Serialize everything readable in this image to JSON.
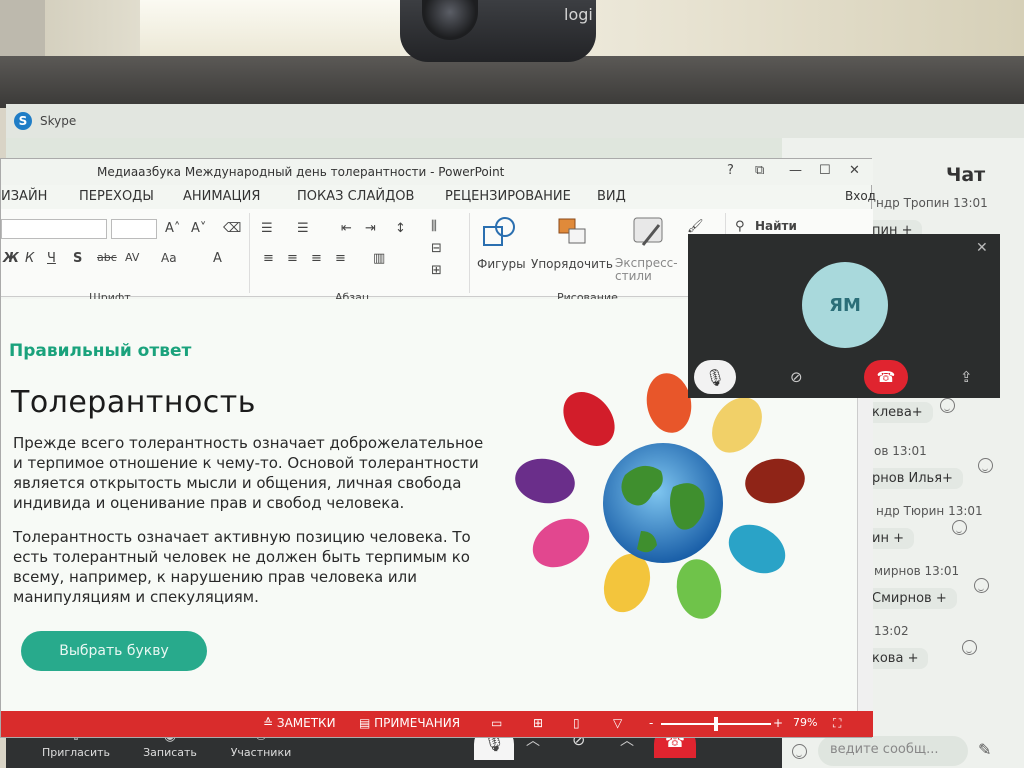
{
  "webcam": {
    "brand": "logi"
  },
  "skype": {
    "title": "Skype",
    "chat": {
      "header": "Чат",
      "rows": [
        {
          "text": "ндр Тропин 13:01"
        },
        {
          "text": "пин +"
        },
        {
          "text": "клева+"
        },
        {
          "text": "ов 13:01"
        },
        {
          "text": "рнов Илья+"
        },
        {
          "text": "ндр Тюрин 13:01"
        },
        {
          "text": "ин +"
        },
        {
          "text": "мирнов 13:01"
        },
        {
          "text": "Смирнов +"
        },
        {
          "text": "13:02"
        },
        {
          "text": "кова +"
        }
      ],
      "input_placeholder": "ведите сообщ..."
    },
    "call_bar": {
      "invite_label": "Пригласить",
      "record_label": "Записать",
      "participants_label": "Участники"
    },
    "call_preview": {
      "initials": "ЯМ"
    }
  },
  "ppt": {
    "title": "Медиаазбука Международный день толерантности - PowerPoint",
    "help": "?",
    "tabs": [
      "ИЗАЙН",
      "ПЕРЕХОДЫ",
      "АНИМАЦИЯ",
      "ПОКАЗ СЛАЙДОВ",
      "РЕЦЕНЗИРОВАНИЕ",
      "ВИД"
    ],
    "signin": "Вход",
    "ribbon": {
      "group_font": "Шрифт",
      "group_paragraph": "Абзац",
      "group_drawing": "Рисование",
      "shapes": "Фигуры",
      "arrange": "Упорядочить",
      "express": "Экспресс-\nстили",
      "find": "Найти"
    },
    "slide": {
      "correct_answer": "Правильный ответ",
      "title": "Толерантность",
      "para1": "Прежде всего толерантность означает доброжелательное и терпимое отношение к чему-то. Основой толерантности является открытость мысли и общения, личная свобода индивида и оценивание прав и свобод человека.",
      "para2": "Толерантность означает активную позицию человека. То есть толерантный человек не должен быть терпимым ко всему, например, к нарушению прав человека или манипуляциям и спекуляциям.",
      "button": "Выбрать букву"
    },
    "status": {
      "notes": "ЗАМЕТКИ",
      "comments": "ПРИМЕЧАНИЯ",
      "zoom_minus": "-",
      "zoom_plus": "+",
      "zoom_value": "79%",
      "zoom_fraction": 0.5
    }
  },
  "colors": {
    "accent_green": "#1aa27c",
    "button_green": "#28aa8c",
    "status_red": "#d92c2c",
    "end_call_red": "#e0242f",
    "avatar_bg": "#a9d9dc"
  }
}
